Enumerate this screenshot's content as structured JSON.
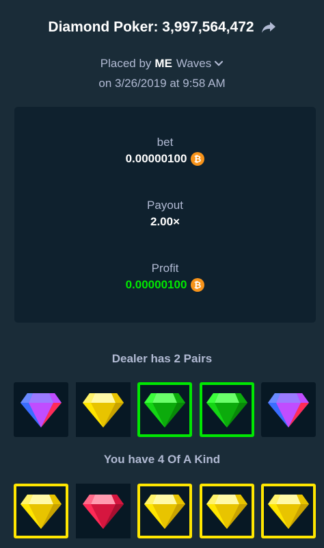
{
  "header": {
    "title": "Diamond Poker: 3,997,564,472"
  },
  "placed": {
    "prefix": "Placed by",
    "user_tag": "ME",
    "user_name": "Waves",
    "date": "on 3/26/2019 at 9:58 AM"
  },
  "stats": {
    "bet_label": "bet",
    "bet_value": "0.00000100",
    "payout_label": "Payout",
    "payout_value": "2.00×",
    "profit_label": "Profit",
    "profit_value": "0.00000100"
  },
  "colors": {
    "background": "#1a2c38",
    "card": "#0f212e",
    "profit_green": "#00e701",
    "coin_orange": "#f7931a"
  },
  "dealer": {
    "result_text": "Dealer has 2 Pairs",
    "gems": [
      {
        "gem": "multicolor",
        "highlight": "multicolor"
      },
      {
        "gem": "yellow",
        "highlight": "none"
      },
      {
        "gem": "green",
        "highlight": "green"
      },
      {
        "gem": "green",
        "highlight": "green"
      },
      {
        "gem": "multicolor",
        "highlight": "multicolor"
      }
    ]
  },
  "player": {
    "result_text": "You have 4 Of A Kind",
    "gems": [
      {
        "gem": "yellow",
        "highlight": "yellow"
      },
      {
        "gem": "red",
        "highlight": "none"
      },
      {
        "gem": "yellow",
        "highlight": "yellow"
      },
      {
        "gem": "yellow",
        "highlight": "yellow"
      },
      {
        "gem": "yellow",
        "highlight": "yellow"
      }
    ]
  },
  "icons": {
    "share": "share-arrow-icon",
    "chevron": "chevron-down-icon",
    "currency": "bitcoin-icon"
  }
}
